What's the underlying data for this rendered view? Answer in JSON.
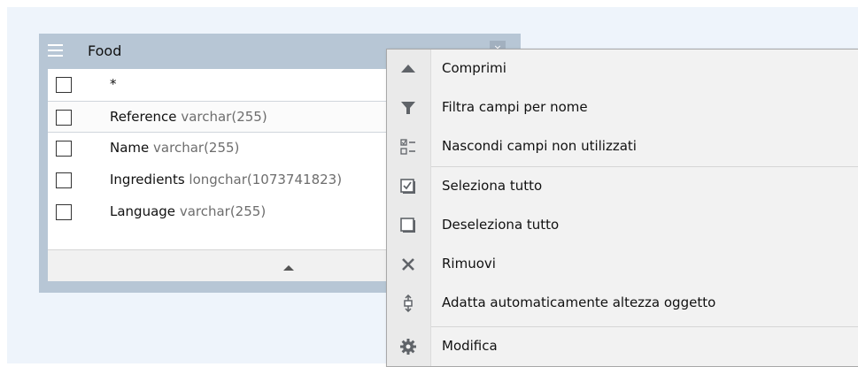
{
  "table": {
    "title": "Food",
    "corner_button_glyph": "×",
    "fields": [
      {
        "name": "*",
        "type": ""
      },
      {
        "name": "Reference",
        "type": "varchar(255)"
      },
      {
        "name": "Name",
        "type": "varchar(255)"
      },
      {
        "name": "Ingredients",
        "type": "longchar(1073741823)"
      },
      {
        "name": "Language",
        "type": "varchar(255)"
      }
    ]
  },
  "context_menu": {
    "items": [
      {
        "label": "Comprimi",
        "icon": "collapse-triangle-icon"
      },
      {
        "label": "Filtra campi per nome",
        "icon": "filter-icon"
      },
      {
        "label": "Nascondi campi non utilizzati",
        "icon": "hide-unused-fields-icon"
      },
      {
        "label": "Seleziona tutto",
        "icon": "checked-box-icon"
      },
      {
        "label": "Deseleziona tutto",
        "icon": "unchecked-box-icon"
      },
      {
        "label": "Rimuovi",
        "icon": "remove-x-icon"
      },
      {
        "label": "Adatta automaticamente altezza oggetto",
        "icon": "auto-height-icon"
      },
      {
        "label": "Modifica",
        "icon": "gear-icon"
      }
    ]
  },
  "colors": {
    "canvas": "#eef4fb",
    "table_header": "#b7c6d5",
    "menu_background": "#f2f2f2",
    "icon_gray": "#5f6368",
    "type_text": "#6d6d6d"
  }
}
